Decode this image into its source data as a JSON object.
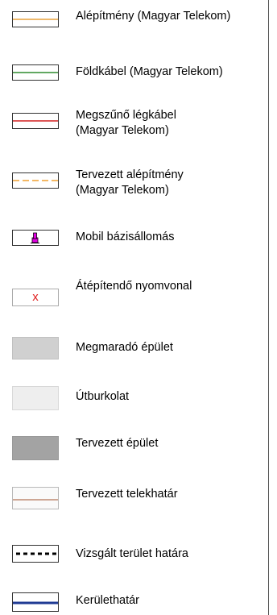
{
  "legend": {
    "items": [
      {
        "label": "Alépítmény (Magyar Telekom)",
        "symbol": "orange-solid-line",
        "color": "#e8a23c"
      },
      {
        "label": "Földkábel (Magyar Telekom)",
        "symbol": "green-solid-line",
        "color": "#2e8b2e"
      },
      {
        "label": "Megszűnő légkábel\n(Magyar Telekom)",
        "symbol": "red-solid-line",
        "color": "#d42020"
      },
      {
        "label": "Tervezett alépítmény\n(Magyar Telekom)",
        "symbol": "orange-dashed-line",
        "color": "#f0a030"
      },
      {
        "label": "Mobil bázisállomás",
        "symbol": "magenta-tower",
        "color": "#e000e0"
      },
      {
        "label": "Átépítendő nyomvonal",
        "symbol": "red-x-mark",
        "color": "#e02020",
        "glyph": "x"
      },
      {
        "label": "Megmaradó épület",
        "symbol": "light-gray-fill",
        "color": "#d0d0d0"
      },
      {
        "label": "Útburkolat",
        "symbol": "very-light-gray-fill",
        "color": "#eeeeee"
      },
      {
        "label": "Tervezett épület",
        "symbol": "dark-gray-fill",
        "color": "#a3a3a3"
      },
      {
        "label": "Tervezett telekhatár",
        "symbol": "brown-thin-line",
        "color": "#a0522d"
      },
      {
        "label": "Vizsgált terület határa",
        "symbol": "black-dotted-line",
        "color": "#000000"
      },
      {
        "label": "Kerülethatár",
        "symbol": "navy-thick-line",
        "color": "#1f3a93"
      }
    ]
  }
}
